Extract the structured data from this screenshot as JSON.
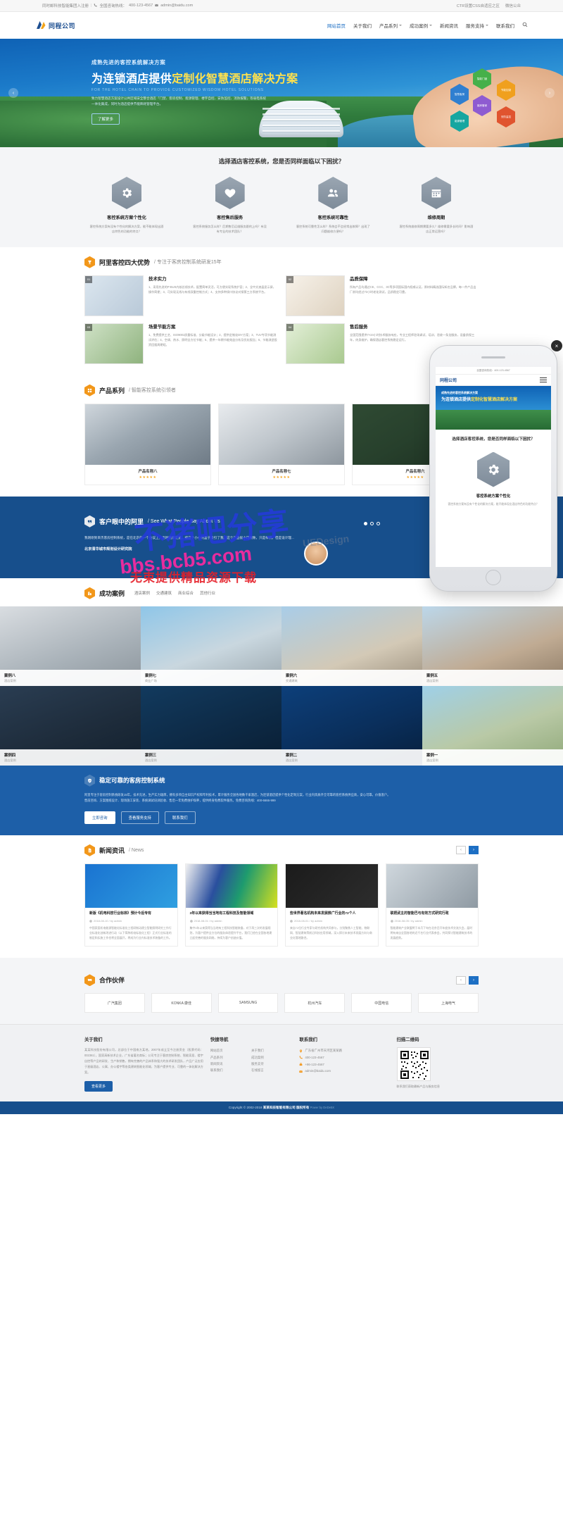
{
  "topbar": {
    "welcome": "同时邮科技智能集团入注册",
    "sep": "|",
    "hotline_label": "全国咨询热线：",
    "hotline": "400-123-4567",
    "email": "admin@baidu.com",
    "favorite": "CTR设置CSS自适应之区",
    "weixin": "微信公众"
  },
  "header": {
    "logo_text": "同程公司",
    "nav": [
      {
        "label": "网站首页",
        "active": true,
        "dropdown": false
      },
      {
        "label": "关于我们",
        "active": false,
        "dropdown": false
      },
      {
        "label": "产品系列",
        "active": false,
        "dropdown": true
      },
      {
        "label": "成功案例",
        "active": false,
        "dropdown": true
      },
      {
        "label": "新闻资讯",
        "active": false,
        "dropdown": false
      },
      {
        "label": "服务支持",
        "active": false,
        "dropdown": true
      },
      {
        "label": "联系我们",
        "active": false,
        "dropdown": false
      }
    ],
    "search_icon": "search-icon"
  },
  "hero": {
    "eyebrow": "成熟先进的客控系统解决方案",
    "title_1": "为连锁酒店提供",
    "title_highlight": "定制化智慧酒店解决方案",
    "english": "FOR THE HOTEL CHAIN TO PROVIDE CUSTOMIZED WISDOM HOTEL SOLUTIONS",
    "desc": "致力智慧酒店方案设计公共区域安全整合酒店「门禁、客房控制、能源管理、楼宇自控、安防监控、消防报警」等弱电系统一体化集成，同时为酒店提供节能降耗管理平台。",
    "button": "了解更多",
    "prev": "‹",
    "next": "›",
    "hex_labels": [
      "智能门锁",
      "节能控制",
      "智慧客房",
      "客房管家",
      "安防监控",
      "能源管理"
    ]
  },
  "pain": {
    "heading": "选择酒店客控系统，您是否同样面临以下困扰？",
    "items": [
      {
        "icon": "gears-icon",
        "title": "客控系统方案个性化",
        "desc": "客控系统方案有没有个性化的解决方案，能不能体现出酒店特色的功能的特点？"
      },
      {
        "icon": "heartbeat-icon",
        "title": "客控售后服务",
        "desc": "客控系统服务怎么样？后期售后运维服务跟的上吗？有没有专业的技术团队？"
      },
      {
        "icon": "users-icon",
        "title": "客控系统可靠性",
        "desc": "客控系统可靠性怎么样？系统会不会经常出故障？出现了问题维修方便吗？"
      },
      {
        "icon": "calendar-icon",
        "title": "维修周期",
        "desc": "客控系统维修周期需要多久？维修需要多长时间？影响酒店正常运营吗？"
      }
    ]
  },
  "advantage": {
    "badge_icon": "trophy-icon",
    "title": "阿里客控四大优势",
    "subtitle": "/ 专注于客房控制系统研发15年",
    "items": [
      {
        "tag": "01",
        "title": "技术实力",
        "desc": "1、采用先进的P-BUS内核总线技术，配置简单灵活，可方便实现系统扩容；2、全中文液晶显示屏，操作简便；3、可实现无线与有线双重控制方式；4、支持多种接口协议对接第三方系统平台。"
      },
      {
        "tag": "02",
        "title": "品质保障",
        "desc": "所有产品均通过CE、CCC、3C等多项国际国内权威认证，原材料精选国际知名品牌，每一件产品出厂前均经过72小时老化测试，品质稳定可靠。"
      },
      {
        "tag": "03",
        "title": "场景节能方案",
        "desc": "1、免费提供工艺、ISO9001质量标准、分级节能设计；2、提供定制化DIY方案；3、TUV专项节能测试评估；4、空调、热水、照明全方位节能；5、提供一年期节能效益分析及优化报告；6、节能改造投资回报周期短。"
      },
      {
        "tag": "04",
        "title": "售后服务",
        "desc": "全国范围提供7×24小时技术服务响应，专业工程师驻场调试、培训、验收一条龙服务，设备质保三年，终身维护，确保酒店客控系统稳定运行。"
      }
    ]
  },
  "products": {
    "badge_icon": "grid-icon",
    "title": "产品系列",
    "subtitle": "/ 智能客控系统引领者",
    "items": [
      {
        "name": "产品名称八",
        "stars": "★★★★★"
      },
      {
        "name": "产品名称七",
        "stars": "★★★★★"
      },
      {
        "name": "产品名称六",
        "stars": "★★★★★"
      }
    ]
  },
  "testimonial": {
    "badge_icon": "quote-icon",
    "title": "客户眼中的阿里",
    "subtitle": "/ See What People Say About Us",
    "quote": "我刚刚到目杰客房控制系统，是在北京的一个会议上，当时随意逛逛，被这个小小的盒子吸引了我，这个产品很小巧精致，只是样机，但是设计理...",
    "author": "北京清华城市规划设计研究院",
    "dots": [
      true,
      false,
      false
    ]
  },
  "cases": {
    "badge_icon": "building-icon",
    "title": "成功案例",
    "tabs": [
      "酒店案例",
      "交通建筑",
      "商业综合",
      "其他行业"
    ],
    "items": [
      {
        "name": "案例八",
        "category": "酒店案例"
      },
      {
        "name": "案例七",
        "category": "商业广场"
      },
      {
        "name": "案例六",
        "category": "交通建筑"
      },
      {
        "name": "案例五",
        "category": "酒店案例"
      },
      {
        "name": "案例四",
        "category": "酒店案例"
      },
      {
        "name": "案例三",
        "category": "酒店案例"
      },
      {
        "name": "案例二",
        "category": "酒店案例"
      },
      {
        "name": "案例一",
        "category": "酒店案例"
      }
    ]
  },
  "cta": {
    "badge_icon": "shield-check-icon",
    "title": "稳定可靠的客房控制系统",
    "line1": "阿里专注于客房控制系统研发15年，技术先进，生产实力雄厚，拥有多项自主知识产权和专利技术，累计服务全国各地数千家酒店，为连锁酒店提供个性化定制方案，行业内资质齐全可靠的客控系统供应商，安心可靠，价值客户。",
    "line2": "售前咨询、方案图纸设计、现场施工安装、系统调试培训验收、售后一年免费维护保养，提供终身免费软件服务。免费咨询热线：400-6666-999",
    "buttons": [
      {
        "label": "立即咨询",
        "solid": true
      },
      {
        "label": "查看服务支持",
        "solid": false
      },
      {
        "label": "联系我们",
        "solid": false
      }
    ]
  },
  "news": {
    "badge_icon": "doc-icon",
    "title": "新闻资讯",
    "subtitle": "/ News",
    "prev": "‹",
    "next": "›",
    "items": [
      {
        "title": "新版《机电科技行业标准》预计今后专有",
        "date": "2018-08-10 / by admin",
        "desc": "中国家庭机电能源智能化标准化工程研制动建立智能照明研究工作行业标准化创新改进行动（以下简称机电标准化工程）正式行业标准的制定和实施工作也将全面展开，将成为行业内标准技术装备的工作。"
      },
      {
        "title": "3年以来获得当当地有工程科技及智能领域",
        "date": "2018-08-01 / by admin",
        "desc": "集中3年以来获得当当地有工程科技智能装备，对于再三次的发展规划，为客户提供全方位的服务体验提升平台，我们已经在全国各地建立起完善的服务网络，持续为客户创造价值。"
      },
      {
        "title": "些世界著名机构未来发展推广行业的72个人",
        "date": "2018-08-01 / by admin",
        "desc": "来自72位行业专家与研究机构共同参与，分别聚焦人工智能、物联网、智慧建筑等前沿科技应用领域，深入探讨未来技术发展方向与商业化落地路径。"
      },
      {
        "title": "联把武主的智能巴与有效方式研究行政",
        "date": "2018-08-05 / by admin",
        "desc": "智能建筑产业联盟将于本月下旬在北京召开年度技术交流大会，届时将有来自全国各地的近千名行业代表参会，共同探讨智能建筑技术的发展趋势。"
      }
    ]
  },
  "partners": {
    "badge_icon": "handshake-icon",
    "title": "合作伙伴",
    "prev": "‹",
    "next": "›",
    "items": [
      {
        "name": "广汽集团",
        "icon": "car-icon"
      },
      {
        "name": "KONKA 康佳",
        "icon": "konka-icon"
      },
      {
        "name": "SAMSUNG",
        "icon": "samsung-icon"
      },
      {
        "name": "杭州汽车",
        "icon": "auto-icon"
      },
      {
        "name": "中国电信",
        "icon": "telecom-icon"
      },
      {
        "name": "上海电气",
        "icon": "electric-icon"
      }
    ]
  },
  "footer": {
    "about": {
      "heading": "关于我们",
      "text": "某某科技股份有限公司，总部位于中国南方某地，2007年成立至今注册资金（股票代码：002361），国家高新技术企业，广东省著名商标；公司专注于客房控制系统、智能家居、楼宇自控等产品的研发、生产和销售，拥有完善的产品体系和强大的技术研发团队，产品广泛应用于星级酒店、公寓、办公楼宇等各类建筑智能化领域，为客户提供专业、可靠的一体化解决方案。",
      "button": "查看更多"
    },
    "links": {
      "heading": "快捷导航",
      "items": [
        "网站首页",
        "关于我们",
        "产品系列",
        "成功案例",
        "新闻资讯",
        "服务支持",
        "联系我们",
        "在线留言"
      ]
    },
    "contact": {
      "heading": "联系我们",
      "items": [
        {
          "icon": "location-icon",
          "text": "广东省广州市天河区某某路"
        },
        {
          "icon": "phone-icon",
          "text": "400-123-4567"
        },
        {
          "icon": "fax-icon",
          "text": "+86-123-4567"
        },
        {
          "icon": "mail-icon",
          "text": "admin@baidu.com"
        }
      ]
    },
    "qr": {
      "heading": "扫描二维码",
      "caption": "联系我们获取最新产品与服务信息"
    }
  },
  "copyright": {
    "text": "Copyright © 2002-2018 ",
    "company": "某某科技智能有限公司 版权所有",
    "powered": "Power by DeDe5X"
  },
  "phone_mockup": {
    "close": "×",
    "status": "全国咨询热线：400-123-4567",
    "logo": "同程公司",
    "hero_line1": "成熟先进的客控系统解决方案",
    "hero_line2_a": "为连锁酒店提供",
    "hero_line2_b": "定制化智慧酒店解决方案",
    "question": "选择酒店客控系统，您是否同样面临以下困扰？",
    "card_title": "客控系统方案个性化",
    "card_desc": "客控系统方案有没有个性化的解决方案，能不能体现出酒店特色的功能特点？"
  },
  "watermarks": {
    "w1": "不猪吧分享",
    "w2": "bbs.bcb5.com",
    "w3": "无束提供精品资源下载",
    "w4": "UEDesign"
  },
  "colors": {
    "brand_blue": "#174f8c",
    "accent_orange": "#f2971a",
    "link_blue": "#1d6fc4",
    "cta_blue": "#1d5fa8"
  }
}
